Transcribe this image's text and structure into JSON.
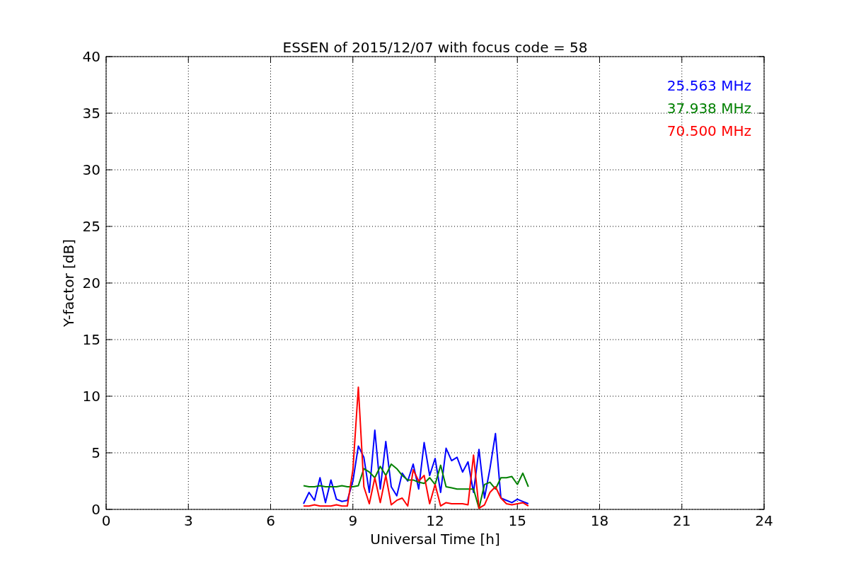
{
  "chart_data": {
    "type": "line",
    "title": "ESSEN of 2015/12/07 with focus code = 58",
    "xlabel": "Universal Time [h]",
    "ylabel": "Y-factor [dB]",
    "x": [
      7.2,
      7.4,
      7.6,
      7.8,
      8.0,
      8.2,
      8.4,
      8.6,
      8.8,
      9.0,
      9.2,
      9.4,
      9.6,
      9.8,
      10.0,
      10.2,
      10.4,
      10.6,
      10.8,
      11.0,
      11.2,
      11.4,
      11.6,
      11.8,
      12.0,
      12.2,
      12.4,
      12.6,
      12.8,
      13.0,
      13.2,
      13.4,
      13.6,
      13.8,
      14.0,
      14.2,
      14.4,
      14.6,
      14.8,
      15.0,
      15.2,
      15.4
    ],
    "series": [
      {
        "name": "25.563 MHz",
        "color": "#0000ff",
        "values": [
          0.5,
          1.5,
          0.8,
          2.8,
          0.6,
          2.6,
          0.9,
          0.7,
          0.8,
          2.5,
          5.6,
          4.6,
          1.5,
          7.0,
          1.8,
          6.0,
          2.0,
          1.2,
          3.2,
          2.5,
          4.0,
          1.8,
          5.9,
          3.0,
          4.5,
          1.5,
          5.4,
          4.3,
          4.6,
          3.3,
          4.2,
          1.5,
          5.3,
          1.0,
          3.6,
          6.7,
          1.0,
          0.8,
          0.6,
          0.9,
          0.7,
          0.5
        ]
      },
      {
        "name": "37.938 MHz",
        "color": "#008000",
        "values": [
          2.1,
          2.0,
          2.0,
          2.1,
          2.0,
          2.0,
          2.0,
          2.1,
          2.0,
          2.0,
          2.1,
          3.6,
          3.3,
          2.8,
          3.8,
          3.0,
          4.0,
          3.6,
          3.0,
          2.6,
          2.6,
          2.4,
          2.3,
          2.8,
          2.2,
          3.9,
          2.0,
          1.9,
          1.8,
          1.8,
          1.8,
          1.8,
          0.1,
          2.2,
          2.4,
          1.8,
          2.8,
          2.8,
          2.9,
          2.2,
          3.2,
          2.0
        ]
      },
      {
        "name": "70.500 MHz",
        "color": "#ff0000",
        "values": [
          0.3,
          0.3,
          0.4,
          0.3,
          0.3,
          0.3,
          0.4,
          0.3,
          0.3,
          3.5,
          10.8,
          2.0,
          0.5,
          2.8,
          0.6,
          3.0,
          0.4,
          0.8,
          1.0,
          0.3,
          3.5,
          2.5,
          3.0,
          0.5,
          2.2,
          0.3,
          0.6,
          0.5,
          0.5,
          0.5,
          0.4,
          4.8,
          0.1,
          0.4,
          1.5,
          2.0,
          1.0,
          0.5,
          0.4,
          0.5,
          0.6,
          0.3
        ]
      }
    ],
    "grid": true,
    "xlim": [
      0,
      24
    ],
    "ylim": [
      0,
      40
    ],
    "xticks": [
      0,
      3,
      6,
      9,
      12,
      15,
      18,
      21,
      24
    ],
    "yticks": [
      0,
      5,
      10,
      15,
      20,
      25,
      30,
      35,
      40
    ]
  }
}
